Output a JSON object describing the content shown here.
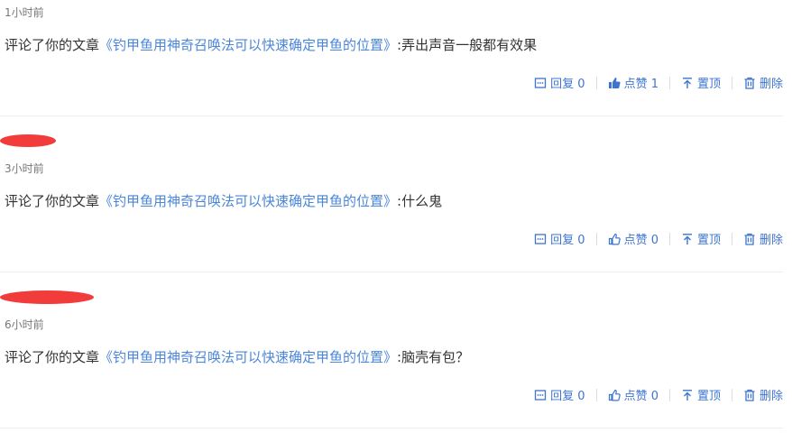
{
  "comments": [
    {
      "time": "1小时前",
      "prefix": "评论了你的文章",
      "article": "《钓甲鱼用神奇召唤法可以快速确定甲鱼的位置》",
      "comment": ":弄出声音一般都有效果",
      "actions": {
        "reply": "回复 0",
        "like": "点赞 1",
        "pin": "置顶",
        "delete": "删除"
      }
    },
    {
      "time": "3小时前",
      "prefix": "评论了你的文章",
      "article": "《钓甲鱼用神奇召唤法可以快速确定甲鱼的位置》",
      "comment": ":什么鬼",
      "actions": {
        "reply": "回复 0",
        "like": "点赞 0",
        "pin": "置顶",
        "delete": "删除"
      }
    },
    {
      "time": "6小时前",
      "prefix": "评论了你的文章",
      "article": "《钓甲鱼用神奇召唤法可以快速确定甲鱼的位置》",
      "comment": ":脑壳有包？",
      "actions": {
        "reply": "回复 0",
        "like": "点赞 0",
        "pin": "置顶",
        "delete": "删除"
      }
    }
  ],
  "colors": {
    "link": "#4a86d9",
    "action": "#3d74d1",
    "redaction": "#f23c3c"
  },
  "icons": {
    "reply": "comment-box-icon",
    "like": "thumbs-up-icon",
    "pin": "arrow-to-top-icon",
    "delete": "trash-icon"
  }
}
